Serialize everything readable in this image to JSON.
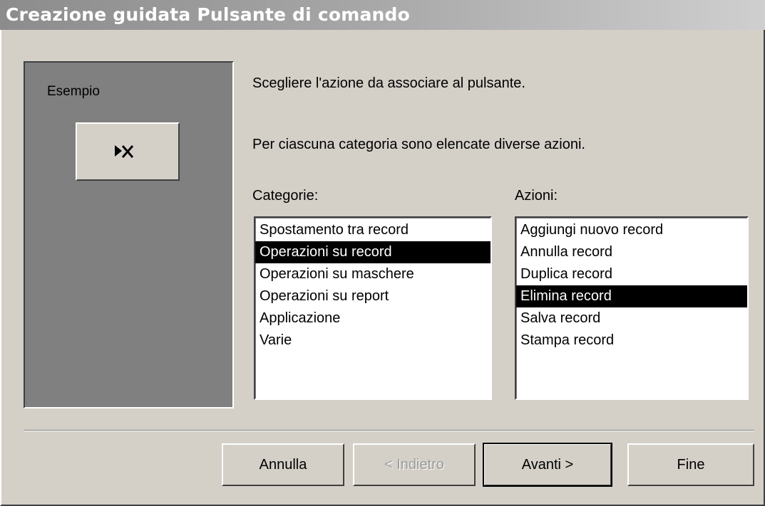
{
  "window": {
    "title": "Creazione guidata Pulsante di comando"
  },
  "preview": {
    "label": "Esempio",
    "icon": "delete-record-icon"
  },
  "instructions": {
    "line1": "Scegliere l'azione da associare al pulsante.",
    "line2": "Per ciascuna categoria sono elencate diverse azioni."
  },
  "categories": {
    "label": "Categorie:",
    "items": [
      "Spostamento tra record",
      "Operazioni su record",
      "Operazioni su maschere",
      "Operazioni su report",
      "Applicazione",
      "Varie"
    ],
    "selected": "Operazioni su record"
  },
  "actions": {
    "label": "Azioni:",
    "items": [
      "Aggiungi nuovo record",
      "Annulla record",
      "Duplica record",
      "Elimina record",
      "Salva record",
      "Stampa record"
    ],
    "selected": "Elimina record"
  },
  "buttons": {
    "cancel": "Annulla",
    "back": "< Indietro",
    "next": "Avanti >",
    "finish": "Fine"
  }
}
